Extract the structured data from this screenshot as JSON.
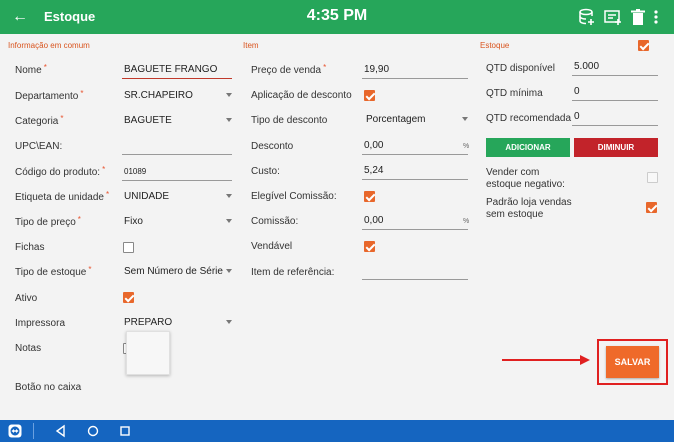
{
  "header": {
    "title": "Estoque",
    "time": "4:35 PM",
    "bg_color": "#26a65a"
  },
  "sections": {
    "info": "Informação em comum",
    "item": "Item",
    "stock": "Estoque"
  },
  "left": {
    "nome_label": "Nome",
    "nome_value": "BAGUETE FRANGO",
    "departamento_label": "Departamento",
    "departamento_value": "SR.CHAPEIRO",
    "categoria_label": "Categoria",
    "categoria_value": "BAGUETE",
    "upc_label": "UPC\\EAN:",
    "upc_value": "",
    "codigo_label": "Código do produto:",
    "codigo_value": "01089",
    "etiqueta_label": "Etiqueta de unidade",
    "etiqueta_value": "UNIDADE",
    "tipo_preco_label": "Tipo de preço",
    "tipo_preco_value": "Fixo",
    "fichas_label": "Fichas",
    "fichas_checked": false,
    "tipo_estoque_label": "Tipo de estoque",
    "tipo_estoque_value": "Sem Número de Série",
    "ativo_label": "Ativo",
    "ativo_checked": true,
    "impressora_label": "Impressora",
    "impressora_value": "PREPARO",
    "notas_label": "Notas",
    "notas_checked": false,
    "botao_caixa_label": "Botão no caixa"
  },
  "middle": {
    "preco_label": "Preço de venda",
    "preco_value": "19,90",
    "aplicacao_label": "Aplicação de desconto",
    "aplicacao_checked": true,
    "tipo_desconto_label": "Tipo de desconto",
    "tipo_desconto_value": "Porcentagem",
    "desconto_label": "Desconto",
    "desconto_value": "0,00",
    "desconto_unit": "%",
    "custo_label": "Custo:",
    "custo_value": "5,24",
    "elegivel_label": "Elegível Comissão:",
    "elegivel_checked": true,
    "comissao_label": "Comissão:",
    "comissao_value": "0,00",
    "comissao_unit": "%",
    "vendavel_label": "Vendável",
    "vendavel_checked": true,
    "referencia_label": "Item de referência:",
    "referencia_value": ""
  },
  "right": {
    "estoque_checked": true,
    "qtd_disponivel_label": "QTD disponível",
    "qtd_disponivel_value": "5.000",
    "qtd_minima_label": "QTD mínima",
    "qtd_minima_value": "0",
    "qtd_recomendada_label": "QTD recomendada",
    "qtd_recomendada_value": "0",
    "adicionar_label": "ADICIONAR",
    "diminuir_label": "DIMINUIR",
    "vender_negativo_line1": "Vender com",
    "vender_negativo_line2": "estoque negativo:",
    "vender_negativo_checked": false,
    "padrao_loja_line1": "Padrão loja vendas",
    "padrao_loja_line2": "sem estoque",
    "padrao_loja_checked": true,
    "salvar_label": "SALVAR"
  },
  "colors": {
    "accent": "#e8672b",
    "green": "#26a65a",
    "red": "#c2232a",
    "nav_blue": "#1565c0"
  }
}
